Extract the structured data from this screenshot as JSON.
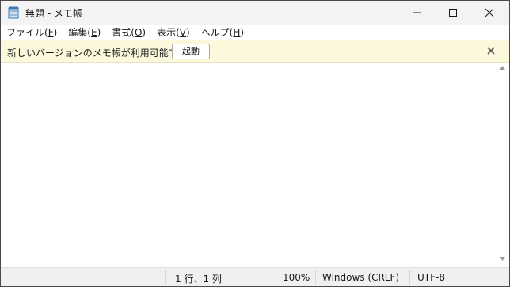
{
  "window": {
    "title": "無題 - メモ帳",
    "controls": {
      "minimize": "minimize",
      "maximize": "maximize",
      "close": "close"
    }
  },
  "menu": {
    "items": [
      {
        "label": "ファイル(",
        "mnemonic": "F",
        "suffix": ")"
      },
      {
        "label": "編集(",
        "mnemonic": "E",
        "suffix": ")"
      },
      {
        "label": "書式(",
        "mnemonic": "O",
        "suffix": ")"
      },
      {
        "label": "表示(",
        "mnemonic": "V",
        "suffix": ")"
      },
      {
        "label": "ヘルプ(",
        "mnemonic": "H",
        "suffix": ")"
      }
    ]
  },
  "notification": {
    "message": "新しいバージョンのメモ帳が利用可能です。",
    "button_label": "起動",
    "close_icon": "close-icon"
  },
  "editor": {
    "content": ""
  },
  "status": {
    "position": "1 行、1 列",
    "zoom": "100%",
    "line_ending": "Windows (CRLF)",
    "encoding": "UTF-8"
  },
  "colors": {
    "titlebar": "#f3f3f3",
    "infobar": "#fcf8dc",
    "statusbar": "#f0f0f0"
  }
}
